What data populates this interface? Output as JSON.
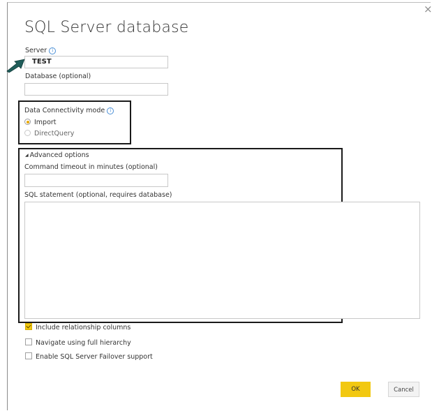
{
  "dialog": {
    "title": "SQL Server database",
    "close_glyph": "×",
    "info_glyph": "i"
  },
  "server": {
    "label": "Server",
    "value": "TEST"
  },
  "database": {
    "label": "Database (optional)",
    "value": ""
  },
  "connectivity": {
    "label": "Data Connectivity mode",
    "options": [
      {
        "label": "Import",
        "selected": true
      },
      {
        "label": "DirectQuery",
        "selected": false
      }
    ]
  },
  "advanced": {
    "header": "Advanced options",
    "toggle_glyph": "◢",
    "timeout_label": "Command timeout in minutes (optional)",
    "timeout_value": "",
    "sql_label": "SQL statement (optional, requires database)",
    "sql_value": ""
  },
  "checkboxes": [
    {
      "label": "Include relationship columns",
      "checked": true
    },
    {
      "label": "Navigate using full hierarchy",
      "checked": false
    },
    {
      "label": "Enable SQL Server Failover support",
      "checked": false
    }
  ],
  "buttons": {
    "ok": "OK",
    "cancel": "Cancel"
  },
  "colors": {
    "accent": "#f2c811",
    "arrow": "#1f5d5a",
    "highlight_border": "#1a1a1a",
    "info": "#4a8fd6"
  },
  "icons": {
    "pointer": "arrow-pointer-icon",
    "info": "info-icon",
    "close": "close-icon"
  }
}
